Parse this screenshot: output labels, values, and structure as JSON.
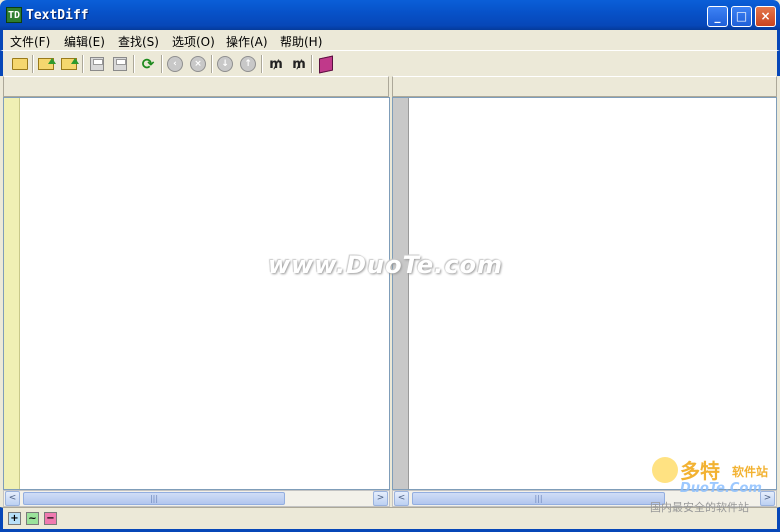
{
  "window": {
    "title": "TextDiff",
    "app_icon": "textdiff-icon"
  },
  "window_buttons": {
    "minimize": "_",
    "maximize": "□",
    "close": "×"
  },
  "menu": [
    "文件(F)",
    "编辑(E)",
    "查找(S)",
    "选项(O)",
    "操作(A)",
    "帮助(H)"
  ],
  "toolbar": [
    "open-folder-icon",
    "open-left-icon",
    "open-right-icon",
    "save-left-icon",
    "save-right-icon",
    "refresh-icon",
    "prev-diff-icon",
    "stop-icon",
    "first-diff-icon",
    "last-diff-icon",
    "find-icon",
    "find-next-icon",
    "help-book-icon"
  ],
  "scroll_arrows": {
    "left": "<",
    "right": ">",
    "grip": "|||"
  },
  "status_legend": [
    {
      "symbol": "+",
      "color": "#b8e0f8"
    },
    {
      "symbol": "~",
      "color": "#9be29b"
    },
    {
      "symbol": "−",
      "color": "#f07ab0"
    }
  ],
  "watermark": {
    "url": "www.DuoTe.com",
    "brand": "多特",
    "brand_sub": "软件站",
    "domain": "DuoTe.Com",
    "tagline": "国内最安全的软件站"
  },
  "colors": {
    "left_gutter": "#f0f0b4",
    "right_gutter": "#c8c8c8",
    "title_blue": "#0752c9"
  }
}
